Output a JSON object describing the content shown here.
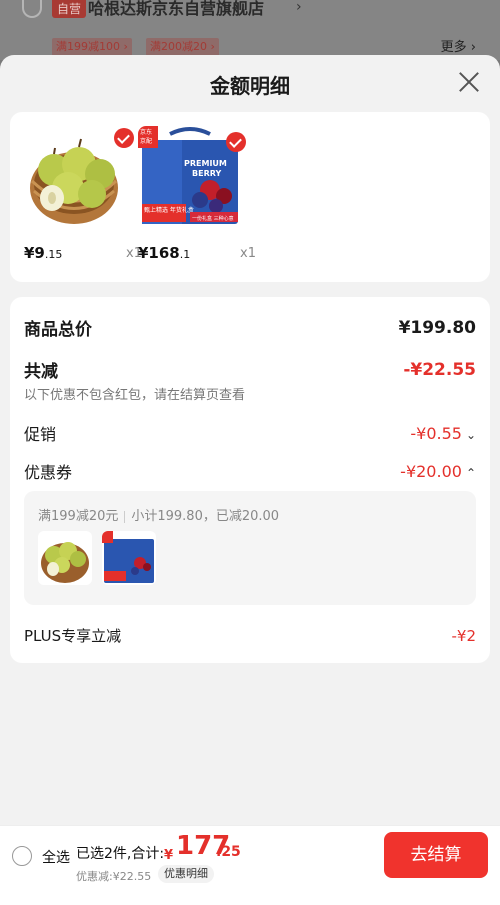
{
  "background": {
    "store_tag": "自营",
    "store_name": "哈根达斯京东自营旗舰店",
    "coupons": [
      "满199减100",
      "满200减20"
    ],
    "more_label": "更多"
  },
  "sheet": {
    "title": "金额明细",
    "products": [
      {
        "price_int": "¥9",
        "price_dec": ".15",
        "qty": "x1",
        "image": "pear-basket"
      },
      {
        "price_int": "¥168",
        "price_dec": ".1",
        "qty": "x1",
        "image": "berry-gift-box"
      }
    ],
    "gift_box_text": {
      "brand_top": "京东",
      "brand_bottom": "京配",
      "headline1": "PREMIUM",
      "headline2": "BERRY",
      "banner": "甄上精选 年货礼盒",
      "tagline": "一份礼盒 三种心意"
    },
    "total_label": "商品总价",
    "total_value": "¥199.80",
    "reduce_label": "共减",
    "reduce_value": "-¥22.55",
    "reduce_note": "以下优惠不包含红包，请在结算页查看",
    "promo_label": "促销",
    "promo_value": "-¥0.55",
    "coupon_label": "优惠券",
    "coupon_value": "-¥20.00",
    "coupon_detail_rule": "满199减20元",
    "coupon_detail_calc": "小计199.80，已减20.00",
    "plus_label": "PLUS专享立减",
    "plus_value": "-¥2"
  },
  "bottom": {
    "select_all": "全选",
    "summary": "已选2件,合计:",
    "total_symbol": "¥",
    "total_int": "177",
    "total_dec": ".25",
    "discount_line": "优惠减:¥22.55",
    "discount_detail": "优惠明细",
    "checkout": "去结算"
  },
  "colors": {
    "accent": "#e4302b",
    "checkout": "#f0332d"
  }
}
